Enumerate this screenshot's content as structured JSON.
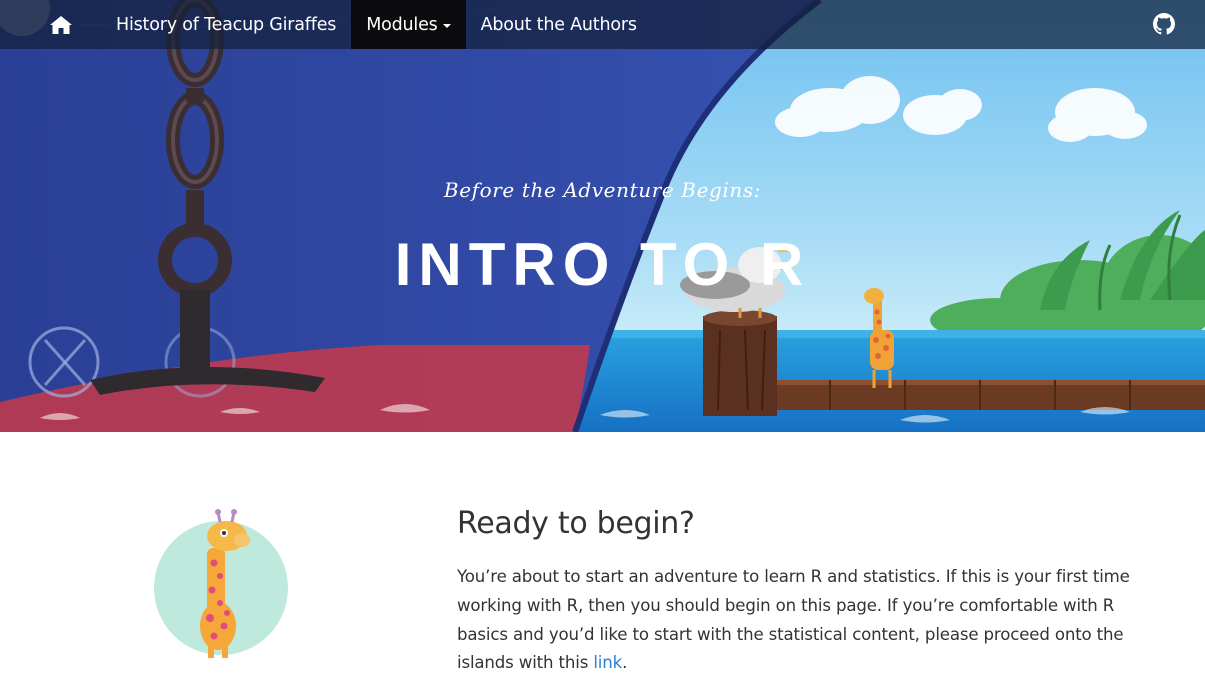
{
  "navbar": {
    "home_icon": "home-icon",
    "items": [
      {
        "label": "History of Teacup Giraffes"
      },
      {
        "label": "Modules"
      },
      {
        "label": "About the Authors"
      }
    ],
    "github_icon": "github-icon"
  },
  "hero": {
    "subtitle": "Before the Adventure Begins:",
    "title": "INTRO TO R"
  },
  "content": {
    "heading": "Ready to begin?",
    "body_before_link": "You’re about to start an adventure to learn R and statistics. If this is your first time working with R, then you should begin on this page. If you’re comfortable with R basics and you’d like to start with the statistical content, please proceed onto the islands with this ",
    "link_text": "link",
    "body_after_link": "."
  },
  "colors": {
    "navbar_bg": "#14203a",
    "active_tab_bg": "#0b0b0d",
    "link": "#2a7fd4",
    "text": "#333333",
    "ship_hull": "#2f47a0",
    "sky": "#7cc6ee",
    "sea": "#1f7fd0"
  }
}
